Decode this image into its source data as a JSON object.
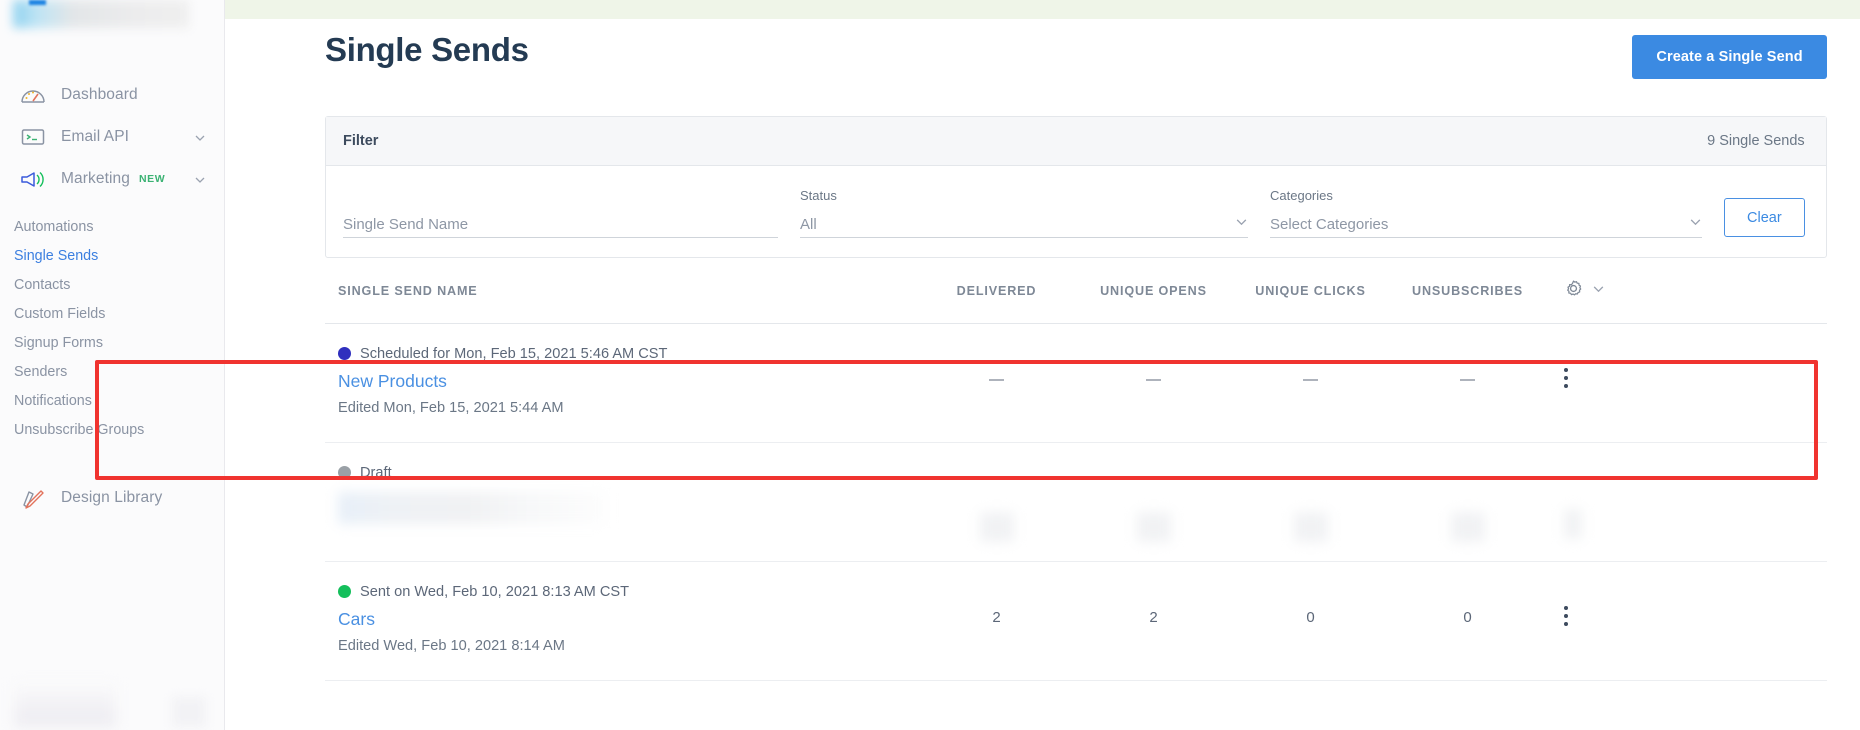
{
  "sidebar": {
    "primary_items": [
      {
        "label": "Dashboard",
        "icon": "gauge-icon",
        "has_chevron": false,
        "badge": null
      },
      {
        "label": "Email API",
        "icon": "terminal-icon",
        "has_chevron": true,
        "badge": null
      },
      {
        "label": "Marketing",
        "icon": "megaphone-icon",
        "has_chevron": true,
        "badge": "NEW"
      }
    ],
    "marketing_subitems": [
      {
        "label": "Automations",
        "active": false
      },
      {
        "label": "Single Sends",
        "active": true
      },
      {
        "label": "Contacts",
        "active": false
      },
      {
        "label": "Custom Fields",
        "active": false
      },
      {
        "label": "Signup Forms",
        "active": false
      },
      {
        "label": "Senders",
        "active": false
      },
      {
        "label": "Notifications",
        "active": false
      },
      {
        "label": "Unsubscribe Groups",
        "active": false
      }
    ],
    "design_library": {
      "label": "Design Library",
      "icon": "ruler-pencil-icon"
    },
    "active_color": "#3b7fe0",
    "badge_color": "#3bb273"
  },
  "header": {
    "title": "Single Sends",
    "create_button": "Create a Single Send",
    "create_button_color": "#3b8ae2"
  },
  "filter": {
    "panel_title": "Filter",
    "count_label": "9 Single Sends",
    "name_field": {
      "label": "",
      "placeholder": "Single Send Name",
      "value": ""
    },
    "status_field": {
      "label": "Status",
      "value": "All"
    },
    "categories_field": {
      "label": "Categories",
      "value": "Select Categories"
    },
    "clear_button": "Clear"
  },
  "table": {
    "columns": [
      "SINGLE SEND NAME",
      "DELIVERED",
      "UNIQUE OPENS",
      "UNIQUE CLICKS",
      "UNSUBSCRIBES"
    ],
    "settings_icon": "gear-icon",
    "rows": [
      {
        "status_text": "Scheduled for Mon, Feb 15, 2021 5:46 AM CST",
        "status_color": "#2f2fbe",
        "name": "New Products",
        "edited": "Edited Mon, Feb 15, 2021 5:44 AM",
        "delivered": "—",
        "unique_opens": "—",
        "unique_clicks": "—",
        "unsubscribes": "—",
        "redacted": false,
        "highlighted": true
      },
      {
        "status_text": "Draft",
        "status_color": "#9aa0a6",
        "name": "",
        "edited": "",
        "delivered": "",
        "unique_opens": "",
        "unique_clicks": "",
        "unsubscribes": "",
        "redacted": true,
        "highlighted": false
      },
      {
        "status_text": "Sent on Wed, Feb 10, 2021 8:13 AM CST",
        "status_color": "#14bf5b",
        "name": "Cars",
        "edited": "Edited Wed, Feb 10, 2021 8:14 AM",
        "delivered": "2",
        "unique_opens": "2",
        "unique_clicks": "0",
        "unsubscribes": "0",
        "redacted": false,
        "highlighted": false
      }
    ]
  },
  "annotation": {
    "box_color": "#f0332f"
  }
}
